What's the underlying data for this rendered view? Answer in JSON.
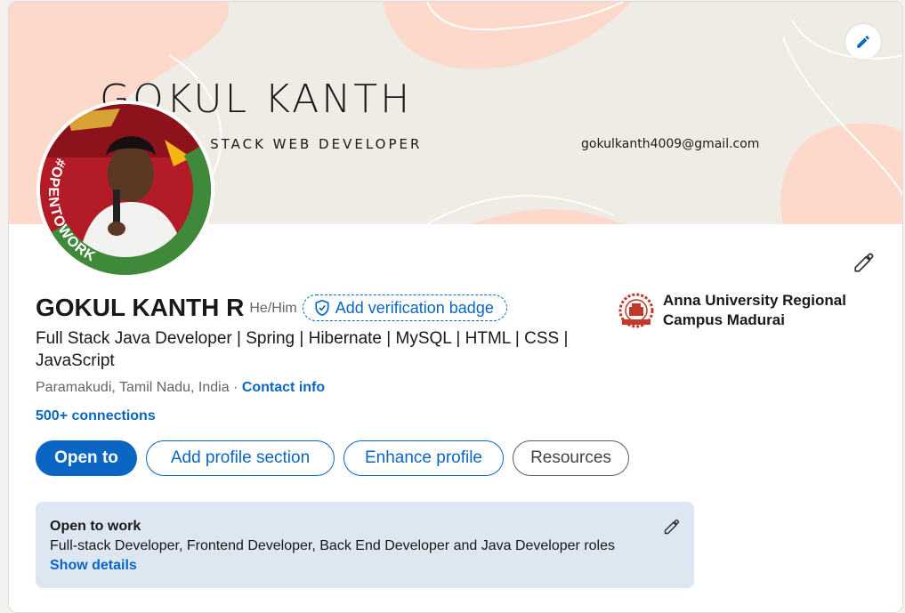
{
  "banner": {
    "name_text": "GOKUL KANTH",
    "role_text": "FULL STACK WEB DEVELOPER",
    "email_text": "gokulkanth4009@gmail.com",
    "edit_icon": "pencil-icon",
    "colors": {
      "background": "#efebe5",
      "accent_blob": "#fdd9cc"
    }
  },
  "avatar": {
    "frame_text": "#OPENTOWORK",
    "frame_color": "#3f8a3a"
  },
  "profile": {
    "name": "GOKUL KANTH R",
    "pronouns": "He/Him",
    "verification_label": "Add verification badge",
    "headline": "Full Stack Java Developer | Spring | Hibernate | MySQL | HTML | CSS | JavaScript",
    "location": "Paramakudi, Tamil Nadu, India",
    "separator": " · ",
    "contact_label": "Contact info",
    "connections": "500+ connections"
  },
  "buttons": {
    "open_to": "Open to",
    "add_section": "Add profile section",
    "enhance": "Enhance profile",
    "resources": "Resources"
  },
  "education": {
    "name": "Anna University Regional Campus Madurai"
  },
  "open_to_work": {
    "title": "Open to work",
    "roles": "Full-stack Developer, Frontend Developer, Back End Developer and Java Developer roles",
    "details_label": "Show details"
  },
  "colors": {
    "brand_blue": "#0a66c2",
    "card_bg": "#ffffff",
    "otw_bg": "#dde7f1"
  }
}
